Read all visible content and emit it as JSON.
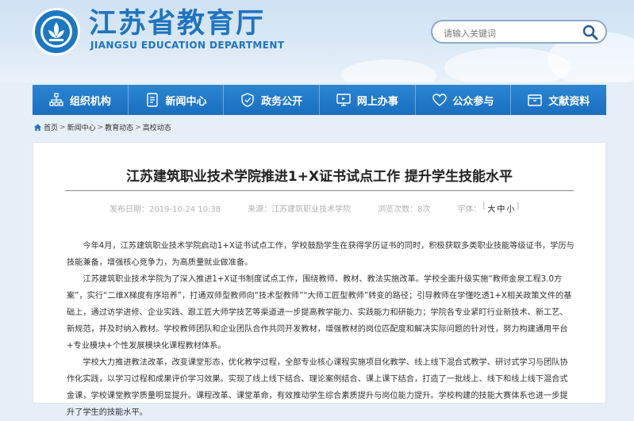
{
  "header": {
    "title": "江苏省教育厅",
    "subtitle": "JIANGSU EDUCATION DEPARTMENT",
    "search_placeholder": "请输入关键词",
    "logo_icon": "logo-emblem-icon",
    "search_icon": "search-icon"
  },
  "nav": {
    "items": [
      {
        "label": "组织机构",
        "icon": "org-chart-icon"
      },
      {
        "label": "新闻中心",
        "icon": "document-icon"
      },
      {
        "label": "政务公开",
        "icon": "shield-icon"
      },
      {
        "label": "网上办事",
        "icon": "monitor-icon"
      },
      {
        "label": "公众参与",
        "icon": "heart-icon"
      },
      {
        "label": "文献资料",
        "icon": "folder-icon"
      }
    ]
  },
  "breadcrumb": {
    "home": "首页",
    "items": [
      "新闻中心",
      "教育动态",
      "高校动态"
    ],
    "sep": ">",
    "home_icon": "home-icon"
  },
  "article": {
    "title": "江苏建筑职业技术学院推进1+X证书试点工作 提升学生技能水平",
    "date": "发布日期：2019-10-24 10:38",
    "source": "来源：江苏建筑职业技术学院",
    "views": "浏览次数：8次",
    "font_label": "字体：",
    "font_open": "[",
    "font_large": "大",
    "font_medium": "中",
    "font_small": "小",
    "font_close": "]",
    "paragraphs": [
      "今年4月，江苏建筑职业技术学院启动1+X证书试点工作，学校鼓励学生在获得学历证书的同时，积极获取多类职业技能等级证书，学历与技能兼备，增强核心竞争力，为高质量就业做准备。",
      "江苏建筑职业技术学院为了深入推进1+X证书制度试点工作，围绕教师、教材、教法实施改革。学校全面升级实施“教师金泉工程3.0方案”，实行“二维X梯度有序培养”，打通双师型教师向“技术型教师”“大师工匠型教师”转变的路径；引导教师在学懂吃透1+X相关政策文件的基础上，通过访学进修、企业实践、跟工匠大师学技艺等渠道进一步提高教学能力、实践能力和研能力；学院各专业紧盯行业新技术、新工艺、新规范，并及时纳入教材。学校教师团队和企业团队合作共同开发教材，增强教材的岗位匹配度和解决实际问题的针对性，努力构建通用平台+专业模块+个性发展模块化课程教材体系。",
      "学校大力推进教法改革，改变课堂形态，优化教学过程，全部专业核心课程实施项目化教学、线上线下混合式教学、研讨式学习与团队协作化实践，以学习过程和成果评价学习效果。实现了线上线下结合、理论案例结合、课上课下结合，打造了一批线上、线下和线上线下混合式金课，学校课堂教学质量明显提升。课程改革、课堂革命，有效推动学生综合素质提升与岗位能力提升。学校构建的技能大赛体系也进一步提升了学生的技能水平。"
    ]
  },
  "colors": {
    "brand_blue": "#1f74c0",
    "nav_blue": "#1a6ec0"
  }
}
